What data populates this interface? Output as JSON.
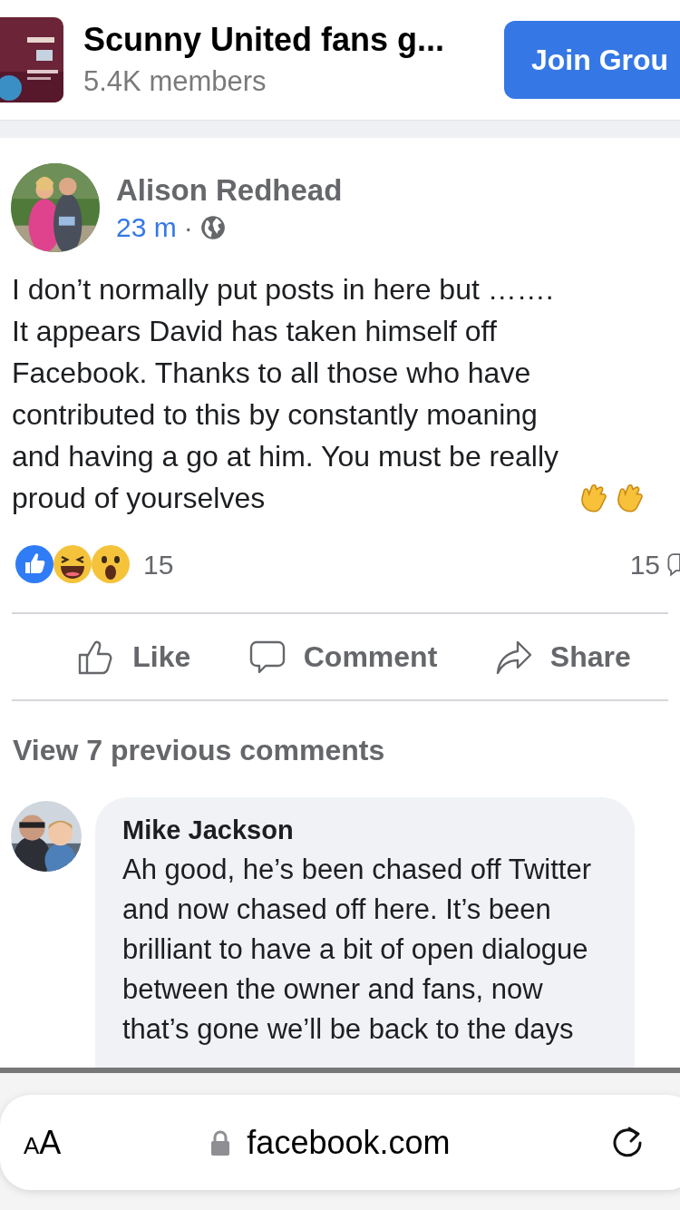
{
  "group": {
    "name": "Scunny United fans g...",
    "members": "5.4K members",
    "join_button": "Join Grou"
  },
  "post": {
    "author": "Alison Redhead",
    "time": "23 m",
    "separator": "·",
    "text": "I don’t normally put posts in here but ……. It appears David has taken himself off Facebook. Thanks to all those who have contributed to this by constantly moaning and having a go at him. You must be really proud of yourselves",
    "reaction_count": "15",
    "comment_count": "15",
    "actions": [
      {
        "kind": "like",
        "label": "Like"
      },
      {
        "kind": "comment",
        "label": "Comment"
      },
      {
        "kind": "share",
        "label": "Share"
      }
    ]
  },
  "view_previous": "View 7 previous comments",
  "comments": [
    {
      "author": "Mike Jackson",
      "text": "Ah good, he’s been chased off Twitter and now chased off here. It’s been brilliant to have a bit of open dialogue between the owner and fans, now that’s gone we’ll be back to the days"
    }
  ],
  "browser_bar": {
    "text_size_button": "AA",
    "url": "facebook.com"
  }
}
